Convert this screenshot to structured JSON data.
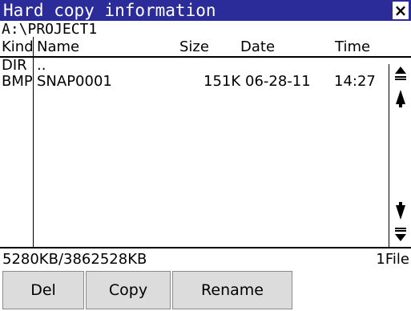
{
  "window": {
    "title": "Hard copy information",
    "close_label": "×"
  },
  "path": "A:\\PROJECT1",
  "columns": {
    "kind": "Kind",
    "name": "Name",
    "size": "Size",
    "date": "Date",
    "time": "Time"
  },
  "rows": [
    {
      "kind": "DIR",
      "name": "..",
      "size": "",
      "date": "",
      "time": ""
    },
    {
      "kind": "BMP",
      "name": "SNAP0001",
      "size": "151K",
      "date": "06-28-11",
      "time": "14:27"
    }
  ],
  "status": {
    "storage": "5280KB/3862528KB",
    "file_count": "1File"
  },
  "buttons": {
    "del": "Del",
    "copy": "Copy",
    "rename": "Rename"
  },
  "scrollbar": {
    "top_icon": "scroll-to-top-icon",
    "up_icon": "scroll-up-icon",
    "down_icon": "scroll-down-icon",
    "bottom_icon": "scroll-to-bottom-icon"
  },
  "colors": {
    "title_bg": "#2b2b9a",
    "button_bg": "#dcdcdc"
  }
}
